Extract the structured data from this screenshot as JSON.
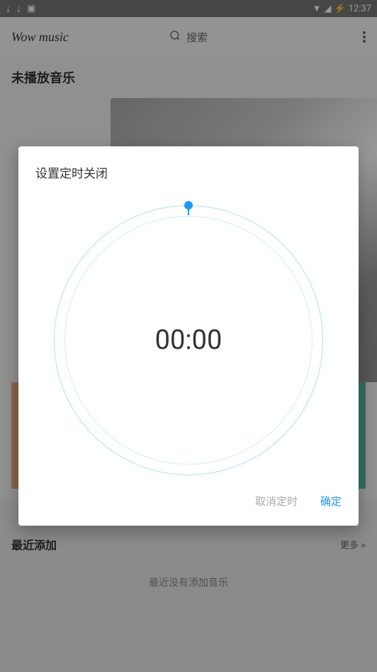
{
  "status_bar": {
    "time": "12:37"
  },
  "header": {
    "app_title": "Wow music",
    "search_label": "搜索"
  },
  "main": {
    "not_playing": "未播放音乐",
    "recent_title": "最近添加",
    "more_label": "更多 >",
    "empty_music": "最近没有添加音乐"
  },
  "dialog": {
    "title": "设置定时关闭",
    "timer_value": "00:00",
    "cancel_label": "取消定时",
    "confirm_label": "确定"
  }
}
